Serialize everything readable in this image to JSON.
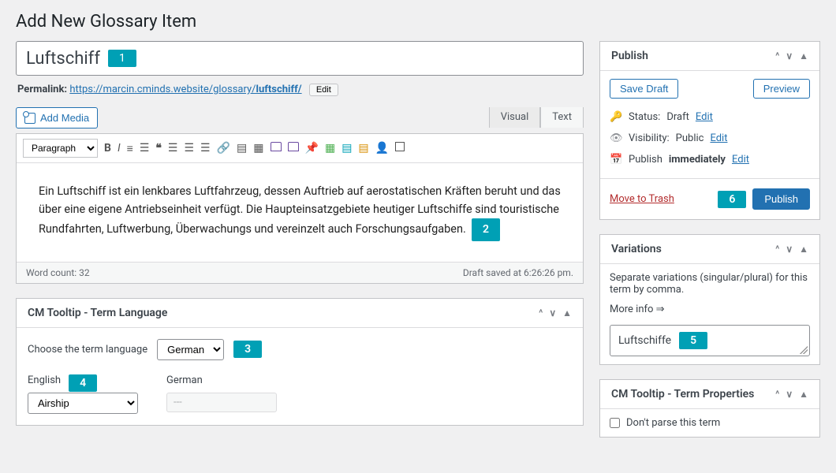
{
  "page": {
    "title": "Add New Glossary Item"
  },
  "title_field": {
    "value": "Luftschiff"
  },
  "permalink": {
    "label": "Permalink:",
    "base": "https://marcin.cminds.website/glossary/",
    "slug": "luftschiff/",
    "edit": "Edit"
  },
  "media_button": "Add Media",
  "editor": {
    "tabs": {
      "visual": "Visual",
      "text": "Text"
    },
    "format": "Paragraph",
    "content": "Ein Luftschiff ist ein lenkbares Luftfahrzeug, dessen Auftrieb auf aerostatischen Kräften beruht und das über eine eigene Antriebseinheit verfügt. Die Haupteinsatzgebiete heutiger Luftschiffe sind touristische Rundfahrten, Luftwerbung, Überwachungs und vereinzelt auch Forschungsaufgaben.",
    "word_count_label": "Word count: 32",
    "saved_label": "Draft saved at 6:26:26 pm."
  },
  "term_language": {
    "box_title": "CM Tooltip - Term Language",
    "choose_label": "Choose the term language",
    "selected": "German",
    "english_label": "English",
    "english_value": "Airship",
    "german_label": "German",
    "german_value": "---"
  },
  "publish": {
    "box_title": "Publish",
    "save_draft": "Save Draft",
    "preview": "Preview",
    "status_label": "Status:",
    "status_value": "Draft",
    "visibility_label": "Visibility:",
    "visibility_value": "Public",
    "schedule_prefix": "Publish",
    "schedule_value": "immediately",
    "edit": "Edit",
    "trash": "Move to Trash",
    "publish_btn": "Publish"
  },
  "variations": {
    "box_title": "Variations",
    "hint": "Separate variations (singular/plural) for this term by comma.",
    "more": "More info ⇒",
    "value": "Luftschiffe"
  },
  "term_properties": {
    "box_title": "CM Tooltip - Term Properties",
    "dont_parse": "Don't parse this term"
  },
  "badges": {
    "b1": "1",
    "b2": "2",
    "b3": "3",
    "b4": "4",
    "b5": "5",
    "b6": "6"
  }
}
